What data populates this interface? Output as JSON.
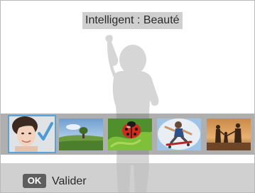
{
  "header": {
    "mode_title": "Intelligent : Beauté"
  },
  "filmstrip": {
    "items": [
      {
        "icon": "portrait-thumbnail-icon",
        "selected": true
      },
      {
        "icon": "landscape-thumbnail-icon",
        "selected": false
      },
      {
        "icon": "macro-ladybug-thumbnail-icon",
        "selected": false
      },
      {
        "icon": "action-thumbnail-icon",
        "selected": false
      },
      {
        "icon": "sunset-family-thumbnail-icon",
        "selected": false
      }
    ]
  },
  "footer": {
    "ok_key": "OK",
    "ok_label": "Valider"
  },
  "colors": {
    "selection_accent": "#5aa3d8",
    "footer_badge": "#5e5e5e"
  }
}
